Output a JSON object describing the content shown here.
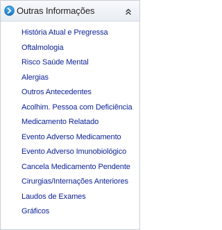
{
  "header": {
    "title": "Outras Informações",
    "icon": "expand-circle-arrow-icon",
    "collapse_icon": "double-chevron-up-icon",
    "accent_color": "#1e8fd8"
  },
  "menu": {
    "link_color": "#0a1f96",
    "items": [
      {
        "label": "História Atual e Pregressa"
      },
      {
        "label": "Oftalmologia"
      },
      {
        "label": "Risco Saúde Mental"
      },
      {
        "label": "Alergias"
      },
      {
        "label": "Outros Antecedentes"
      },
      {
        "label": "Acolhim. Pessoa com Deficiência"
      },
      {
        "label": "Medicamento Relatado"
      },
      {
        "label": "Evento Adverso Medicamento"
      },
      {
        "label": "Evento Adverso Imunobiológico"
      },
      {
        "label": "Cancela Medicamento Pendente"
      },
      {
        "label": "Cirurgias/Internações Anteriores"
      },
      {
        "label": "Laudos de Exames"
      },
      {
        "label": "Gráficos"
      }
    ]
  }
}
